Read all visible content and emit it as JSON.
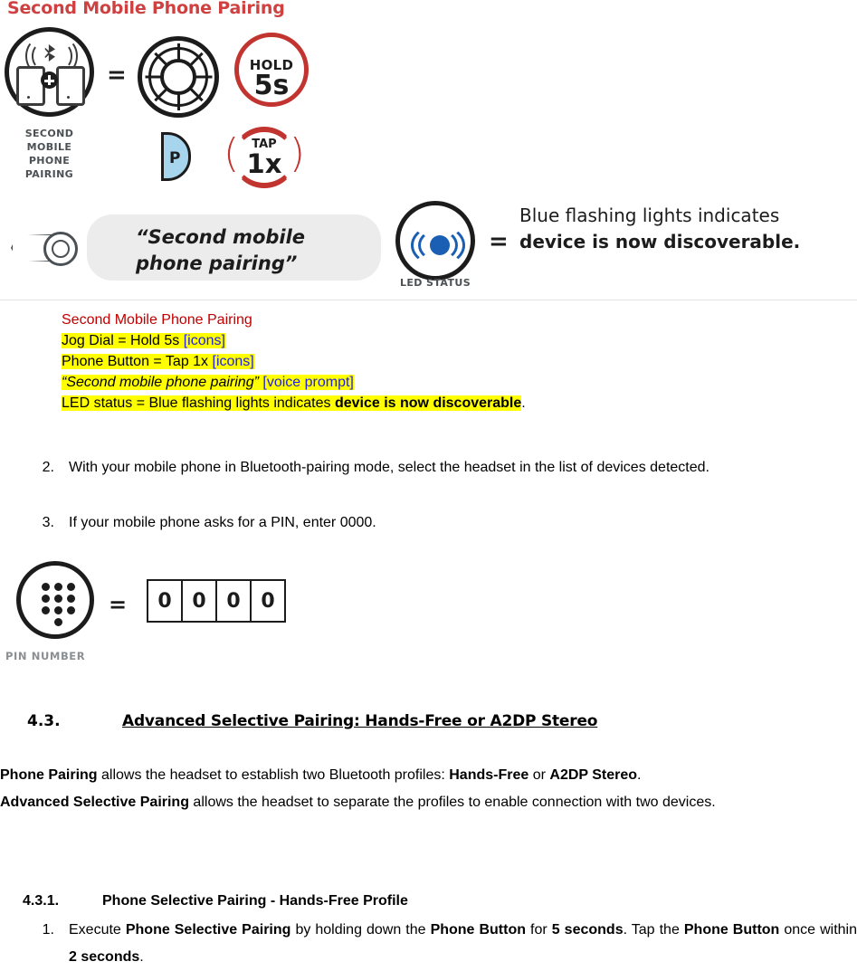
{
  "infographic": {
    "title": "Second Mobile Phone Pairing",
    "second_phone_caption": "SECOND\nMOBILE\nPHONE\nPAIRING",
    "second_phone_caption_lines": [
      "SECOND",
      "MOBILE",
      "PHONE",
      "PAIRING"
    ],
    "equals": "=",
    "jog_dial": {
      "hold_label": "HOLD",
      "hold_value": "5s"
    },
    "phone_button": {
      "letter": "P",
      "tap_label": "TAP",
      "tap_value": "1x"
    },
    "voice_prompt": "“Second mobile\nphone pairing”",
    "voice_prompt_lines": [
      "“Second mobile",
      "phone pairing”"
    ],
    "led": {
      "caption": "LED STATUS",
      "equals": "=",
      "text_plain": "Blue flashing lights indicates ",
      "text_bold": "device is now discoverable."
    },
    "colors": {
      "title_red": "#cf4040",
      "accent_red": "#c1342f",
      "led_blue": "#1a5fb4",
      "button_blue": "#a8d5ee",
      "pill_grey": "#ececec"
    }
  },
  "annotation": {
    "line1": "Second Mobile Phone Pairing",
    "line2_a": "Jog Dial = Hold 5s ",
    "line2_b": "[icons]",
    "line3_a": "Phone Button = Tap 1x ",
    "line3_b": "[icons]",
    "line4_a": "“Second mobile phone pairing”",
    "line4_b": " [voice prompt]",
    "line5_a": "LED status = Blue flashing lights indicates ",
    "line5_b": "device is now discoverable",
    "line5_c": "."
  },
  "steps": [
    {
      "num": "2.",
      "text": "With your mobile phone in Bluetooth-pairing mode, select the headset in the list of devices detected."
    },
    {
      "num": "3.",
      "text": "If your mobile phone asks for a PIN, enter 0000."
    }
  ],
  "pin_graphic": {
    "label": "PIN NUMBER",
    "equals": "=",
    "digits": [
      "0",
      "0",
      "0",
      "0"
    ]
  },
  "section": {
    "number": "4.3.",
    "title": "Advanced Selective Pairing: Hands-Free or A2DP Stereo"
  },
  "paragraph1": {
    "b1": "Phone Pairing",
    "t1": " allows the headset to establish two Bluetooth profiles: ",
    "b2": "Hands-Free",
    "t2": " or ",
    "b3": "A2DP Stereo",
    "t3": "."
  },
  "paragraph2": {
    "b1": "Advanced Selective Pairing",
    "t1": " allows the headset to separate the profiles to enable connection with two devices."
  },
  "subsection": {
    "number": "4.3.1.",
    "title": "Phone Selective Pairing - Hands-Free Profile"
  },
  "substep": {
    "num": "1.",
    "t1": "Execute ",
    "b1": "Phone Selective Pairing",
    "t2": " by holding down the ",
    "b2": "Phone Button",
    "t3": " for ",
    "b3": "5 seconds",
    "t4": ". Tap the ",
    "b4": "Phone Button",
    "t5": " once within ",
    "b5": "2 seconds",
    "t6": "."
  }
}
